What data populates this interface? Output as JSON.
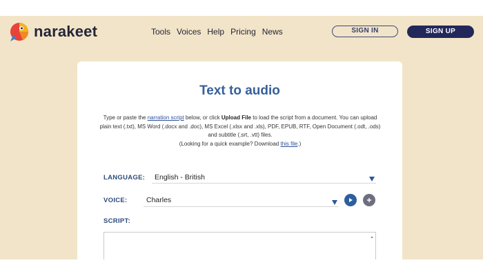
{
  "brand": {
    "name": "narakeet"
  },
  "nav": {
    "items": [
      "Tools",
      "Voices",
      "Help",
      "Pricing",
      "News"
    ]
  },
  "auth": {
    "sign_in": "SIGN IN",
    "sign_up": "SIGN UP"
  },
  "card": {
    "title": "Text to audio",
    "intro": {
      "p1_before": "Type or paste the ",
      "p1_link": "narration script",
      "p1_mid": " below, or click ",
      "p1_bold": "Upload File",
      "p1_after": " to load the script from a document. You can upload plain text (.txt), MS Word (.docx and .doc), MS Excel (.xlsx and .xls), PDF, EPUB, RTF, Open Document (.odt, .ods) and subtitle (.srt, .vtt) files.",
      "p2_before": "(Looking for a quick example? Download ",
      "p2_link": "this file",
      "p2_after": ".)"
    },
    "language": {
      "label": "LANGUAGE:",
      "value": "English - British"
    },
    "voice": {
      "label": "VOICE:",
      "value": "Charles"
    },
    "script": {
      "label": "SCRIPT:",
      "value": ""
    }
  },
  "colors": {
    "background": "#f2e4c8",
    "accent": "#2c5797",
    "title": "#35609a",
    "button_dark": "#23285a"
  },
  "icons": [
    "parrot-logo-icon",
    "dropdown-triangle-icon",
    "play-icon",
    "plus-icon"
  ]
}
